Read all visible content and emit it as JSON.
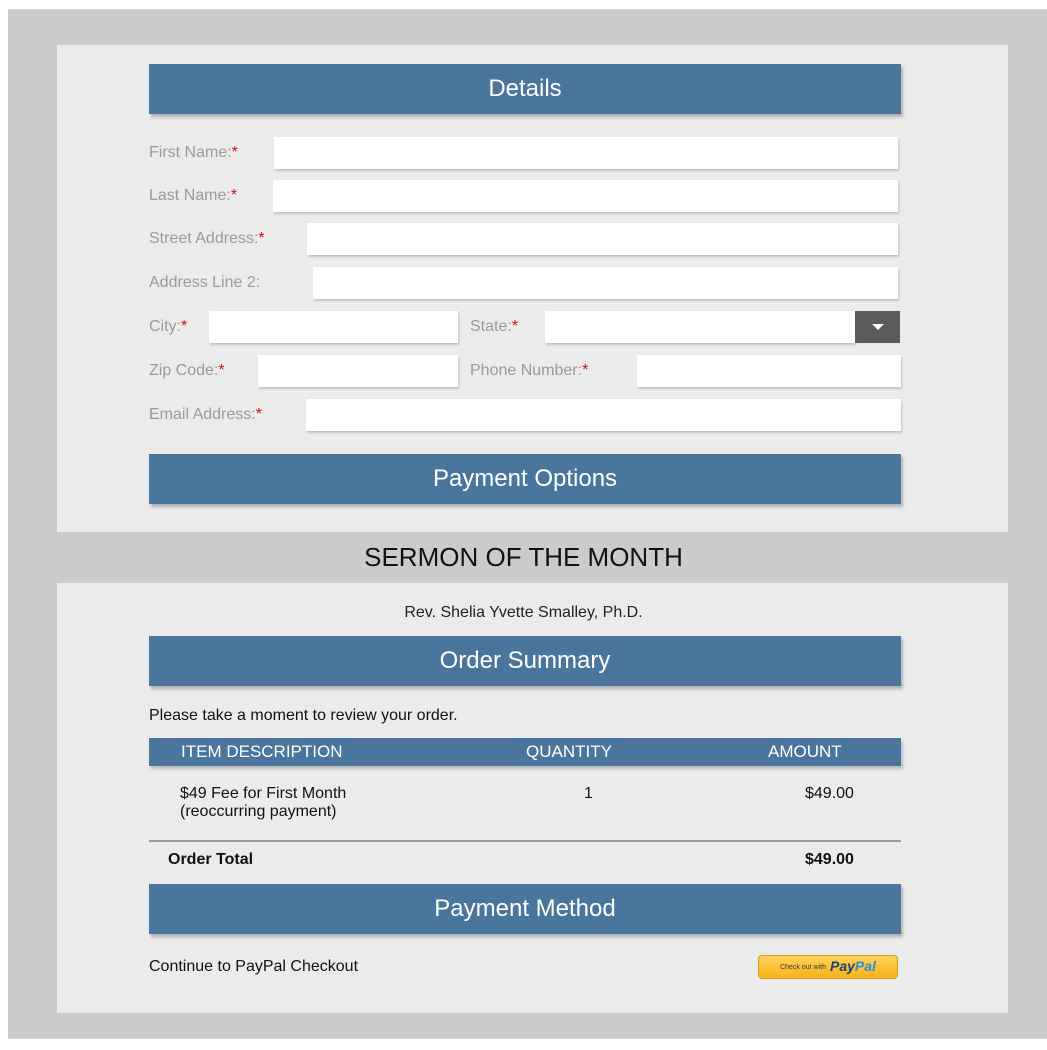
{
  "details": {
    "title": "Details",
    "fields": {
      "first_name": "First Name:",
      "last_name": "Last Name:",
      "street_address": "Street Address:",
      "address_line_2": "Address Line 2:",
      "city": "City:",
      "state": "State:",
      "zip_code": "Zip Code:",
      "phone_number": "Phone Number:",
      "email_address": "Email Address:"
    },
    "required_mark": "*",
    "values": {
      "first_name": "",
      "last_name": "",
      "street_address": "",
      "address_line_2": "",
      "city": "",
      "state": "",
      "zip_code": "",
      "phone_number": "",
      "email_address": ""
    }
  },
  "payment_options": {
    "title": "Payment Options"
  },
  "sermon": {
    "title": "SERMON OF THE MONTH",
    "author": "Rev. Shelia Yvette Smalley, Ph.D."
  },
  "order_summary": {
    "title": "Order Summary",
    "intro": "Please take a moment to review your order.",
    "columns": [
      "ITEM DESCRIPTION",
      "QUANTITY",
      "AMOUNT"
    ],
    "rows": [
      {
        "description_line1": "$49 Fee for First Month",
        "description_line2": "(reoccurring payment)",
        "quantity": "1",
        "amount": "$49.00"
      }
    ],
    "total_label": "Order Total",
    "total_value": "$49.00"
  },
  "payment_method": {
    "title": "Payment Method",
    "paypal_text": "Continue to PayPal Checkout",
    "paypal_button": {
      "small_text": "Check out with",
      "pay": "Pay",
      "pal": "Pal"
    }
  },
  "colors": {
    "accent": "#4a759c",
    "required": "#cc1111",
    "panel": "#ebebeb",
    "frame": "#cbcbcb"
  }
}
